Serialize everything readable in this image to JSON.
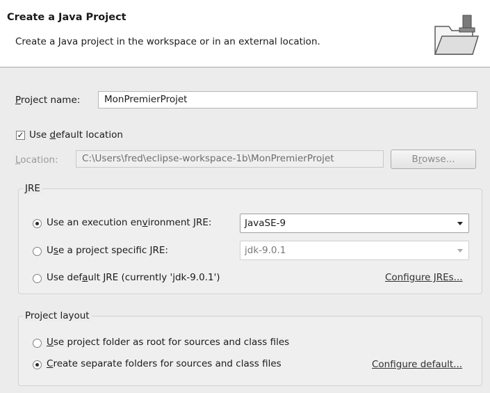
{
  "header": {
    "title": "Create a Java Project",
    "subtitle": "Create a Java project in the workspace or in an external location."
  },
  "project_name": {
    "label_u": "P",
    "label_rest": "roject name:",
    "value": "MonPremierProjet"
  },
  "default_location": {
    "checked": true,
    "label_pre": "Use ",
    "label_u": "d",
    "label_rest": "efault location"
  },
  "location": {
    "label_u": "L",
    "label_rest": "ocation:",
    "value": "C:\\Users\\fred\\eclipse-workspace-1b\\MonPremierProjet",
    "browse_pre": "B",
    "browse_u": "r",
    "browse_rest": "owse..."
  },
  "jre": {
    "group_title": "JRE",
    "opt1_pre": "Use an execution en",
    "opt1_u": "v",
    "opt1_rest": "ironment JRE:",
    "opt1_value": "JavaSE-9",
    "opt2_pre": "U",
    "opt2_u": "s",
    "opt2_rest": "e a project specific JRE:",
    "opt2_value": "jdk-9.0.1",
    "opt3_pre": "Use def",
    "opt3_u": "a",
    "opt3_rest": "ult JRE (currently 'jdk-9.0.1')",
    "configure_link": "Configure JREs...",
    "selected": "execution-environment"
  },
  "layout": {
    "group_title": "Project layout",
    "opt1_u": "U",
    "opt1_rest": "se project folder as root for sources and class files",
    "opt2_u": "C",
    "opt2_rest": "reate separate folders for sources and class files",
    "configure_link": "Configure default...",
    "selected": "separate-folders"
  }
}
